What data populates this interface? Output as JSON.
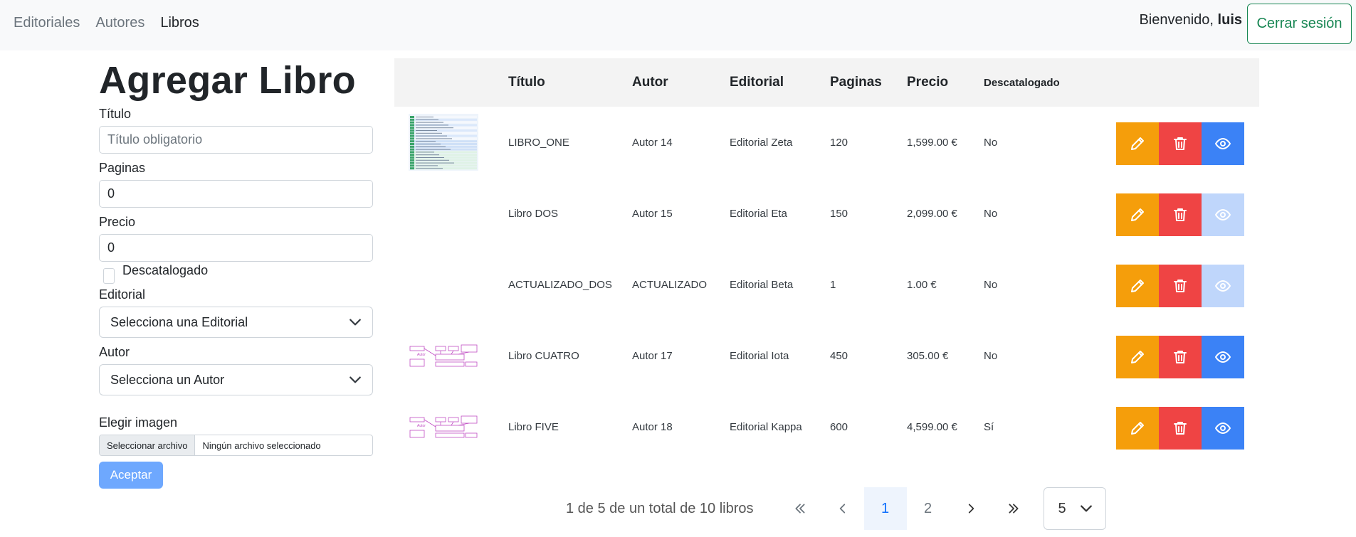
{
  "nav": {
    "links": [
      "Editoriales",
      "Autores",
      "Libros"
    ],
    "welcome_prefix": "Bienvenido,",
    "username": "luis",
    "logout": "Cerrar sesión"
  },
  "form": {
    "title": "Agregar Libro",
    "titulo_label": "Título",
    "titulo_placeholder": "Título obligatorio",
    "paginas_label": "Paginas",
    "paginas_value": "0",
    "precio_label": "Precio",
    "precio_value": "0",
    "descatalogado_label": "Descatalogado",
    "editorial_label": "Editorial",
    "editorial_select": "Selecciona una Editorial",
    "autor_label": "Autor",
    "autor_select": "Selecciona un Autor",
    "imagen_label": "Elegir imagen",
    "file_button": "Seleccionar archivo",
    "file_status": "Ningún archivo seleccionado",
    "submit": "Aceptar"
  },
  "table": {
    "headers": [
      "Título",
      "Autor",
      "Editorial",
      "Paginas",
      "Precio",
      "Descatalogado"
    ],
    "rows": [
      {
        "titulo": "LIBRO_ONE",
        "autor": "Autor 14",
        "editorial": "Editorial Zeta",
        "paginas": "120",
        "precio": "1,599.00 €",
        "descatalogado": "No",
        "thumb": "table",
        "view_enabled": true
      },
      {
        "titulo": "Libro DOS",
        "autor": "Autor 15",
        "editorial": "Editorial Eta",
        "paginas": "150",
        "precio": "2,099.00 €",
        "descatalogado": "No",
        "thumb": "none",
        "view_enabled": false
      },
      {
        "titulo": "ACTUALIZADO_DOS",
        "autor": "ACTUALIZADO",
        "editorial": "Editorial Beta",
        "paginas": "1",
        "precio": "1.00 €",
        "descatalogado": "No",
        "thumb": "none",
        "view_enabled": false
      },
      {
        "titulo": "Libro CUATRO",
        "autor": "Autor 17",
        "editorial": "Editorial Iota",
        "paginas": "450",
        "precio": "305.00 €",
        "descatalogado": "No",
        "thumb": "diagram",
        "view_enabled": true
      },
      {
        "titulo": "Libro FIVE",
        "autor": "Autor 18",
        "editorial": "Editorial Kappa",
        "paginas": "600",
        "precio": "4,599.00 €",
        "descatalogado": "Sí",
        "thumb": "diagram",
        "view_enabled": true
      }
    ]
  },
  "pagination": {
    "info": "1 de 5 de un total de 10 libros",
    "pages": [
      "1",
      "2"
    ],
    "current": "1",
    "page_size": "5"
  },
  "colors": {
    "edit": "#f59e0b",
    "delete": "#ef4444",
    "view": "#3b82f6",
    "view_disabled": "#bfd6fb",
    "submit": "#6ea8fe",
    "logout": "#198754"
  }
}
